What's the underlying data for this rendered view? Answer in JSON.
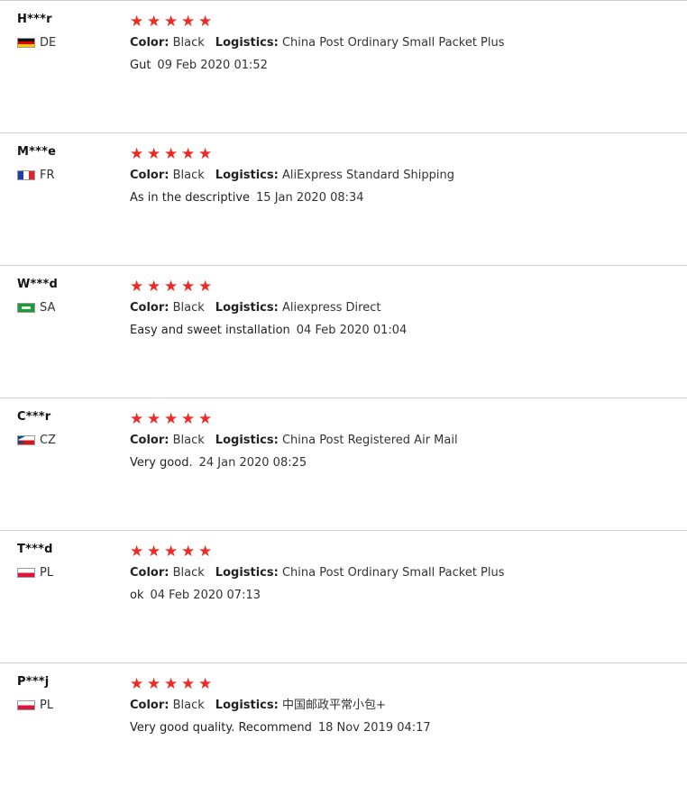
{
  "labels": {
    "color": "Color:",
    "logistics": "Logistics:"
  },
  "star_glyph": "★",
  "reviews": [
    {
      "user": "H***r",
      "country": "DE",
      "rating": 5,
      "color": "Black",
      "logistics": "China Post Ordinary Small Packet Plus",
      "comment": "Gut",
      "date": "09 Feb 2020 01:52"
    },
    {
      "user": "M***e",
      "country": "FR",
      "rating": 5,
      "color": "Black",
      "logistics": "AliExpress Standard Shipping",
      "comment": "As in the descriptive",
      "date": "15 Jan 2020 08:34"
    },
    {
      "user": "W***d",
      "country": "SA",
      "rating": 5,
      "color": "Black",
      "logistics": "Aliexpress Direct",
      "comment": "Easy and sweet installation",
      "date": "04 Feb 2020 01:04"
    },
    {
      "user": "C***r",
      "country": "CZ",
      "rating": 5,
      "color": "Black",
      "logistics": "China Post Registered Air Mail",
      "comment": "Very good.",
      "date": "24 Jan 2020 08:25"
    },
    {
      "user": "T***d",
      "country": "PL",
      "rating": 5,
      "color": "Black",
      "logistics": "China Post Ordinary Small Packet Plus",
      "comment": "ok",
      "date": "04 Feb 2020 07:13"
    },
    {
      "user": "P***j",
      "country": "PL",
      "rating": 5,
      "color": "Black",
      "logistics": "中国邮政平常小包+",
      "comment": "Very good quality. Recommend",
      "date": "18 Nov 2019 04:17"
    }
  ],
  "colors": {
    "star": "#ee2a24",
    "divider": "#cfcfcf",
    "text": "#333333"
  }
}
